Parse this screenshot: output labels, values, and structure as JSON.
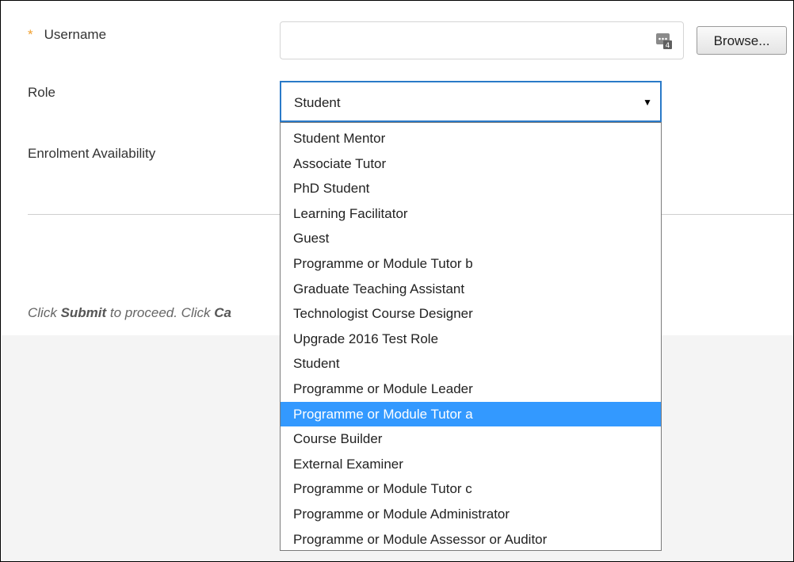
{
  "form": {
    "username": {
      "required_mark": "*",
      "label": "Username",
      "value": ""
    },
    "browse_label": "Browse...",
    "role": {
      "label": "Role",
      "selected": "Student"
    },
    "enrolment_label": "Enrolment Availability",
    "instructions": {
      "part1": "Click ",
      "submit": "Submit",
      "part2": " to proceed. Click ",
      "cancel_partial": "Ca"
    }
  },
  "dropdown": {
    "highlighted_index": 11,
    "options": [
      "Student Mentor",
      "Associate Tutor",
      "PhD Student",
      "Learning Facilitator",
      "Guest",
      "Programme or Module Tutor b",
      "Graduate Teaching Assistant",
      "Technologist Course Designer",
      "Upgrade 2016 Test Role",
      "Student",
      "Programme or Module Leader",
      "Programme or Module Tutor a",
      "Course Builder",
      "External Examiner",
      "Programme or Module Tutor c",
      "Programme or Module Administrator",
      "Programme or Module Assessor or Auditor"
    ]
  },
  "colors": {
    "required": "#f0a030",
    "focus_border": "#2a7ac8",
    "highlight": "#3399ff"
  },
  "icons": {
    "picker": "user-picker-icon",
    "dropdown_arrow": "chevron-down-icon"
  }
}
